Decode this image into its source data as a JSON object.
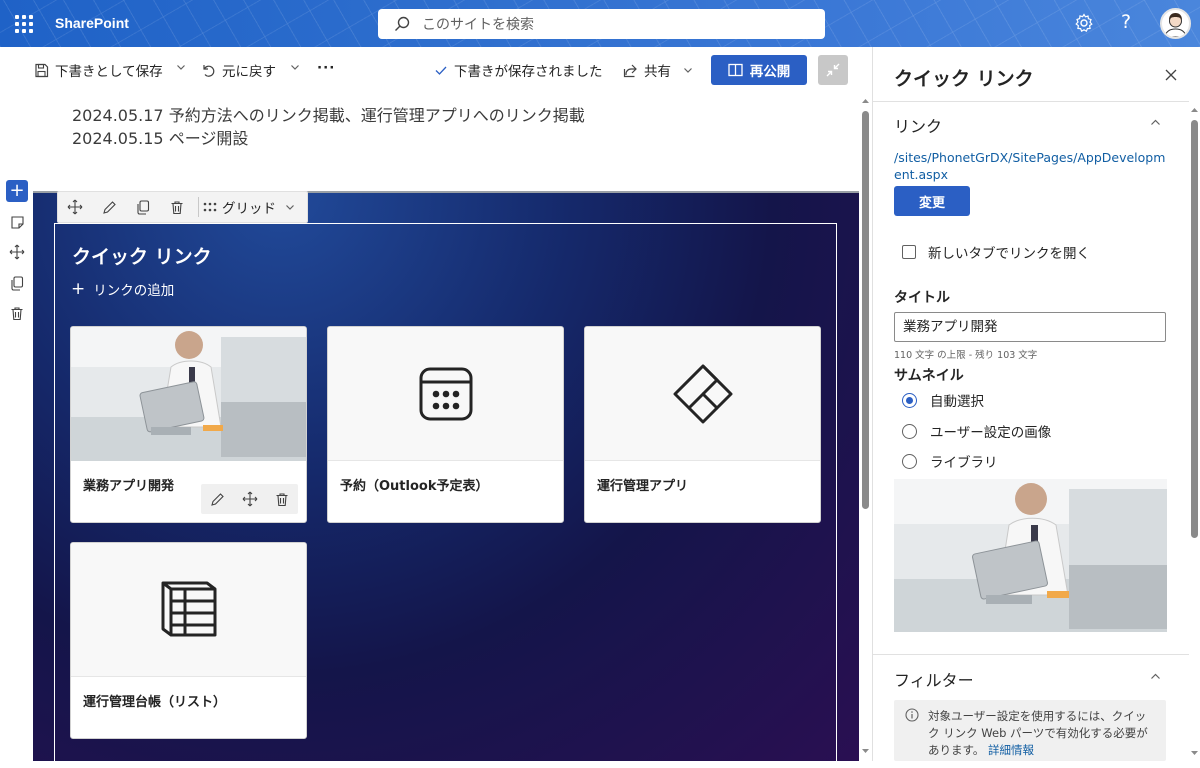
{
  "suitebar": {
    "brand": "SharePoint",
    "search_placeholder": "このサイトを検索"
  },
  "cmdbar": {
    "save_draft": "下書きとして保存",
    "undo": "元に戻す",
    "more": "···",
    "saved_status": "下書きが保存されました",
    "share": "共有",
    "republish": "再公開"
  },
  "content": {
    "news_lines": [
      "2024.05.17 予約方法へのリンク掲載、運行管理アプリへのリンク掲載",
      "2024.05.15 ページ開設"
    ],
    "webpart_toolbar": {
      "layout_label": "グリッド"
    },
    "quick_links": {
      "title": "クイック リンク",
      "add_link": "リンクの追加",
      "cards": [
        {
          "label": "業務アプリ開発",
          "thumb_icon": "photo-thumbnail"
        },
        {
          "label": "予約（Outlook予定表）",
          "thumb_icon": "calendar-icon"
        },
        {
          "label": "運行管理アプリ",
          "thumb_icon": "power-apps-icon"
        },
        {
          "label": "運行管理台帳（リスト）",
          "thumb_icon": "list-icon"
        }
      ]
    }
  },
  "panel": {
    "title": "クイック リンク",
    "link_section": {
      "heading": "リンク",
      "url": "/sites/PhonetGrDX/SitePages/AppDevelopment.aspx",
      "change_button": "変更",
      "new_tab_label": "新しいタブでリンクを開く",
      "new_tab_checked": false
    },
    "title_field": {
      "label": "タイトル",
      "value": "業務アプリ開発",
      "hint": "110 文字 の上限 - 残り 103 文字"
    },
    "thumbnail": {
      "label": "サムネイル",
      "options": [
        "自動選択",
        "ユーザー設定の画像",
        "ライブラリ"
      ],
      "selected": "自動選択"
    },
    "filter_section": {
      "heading": "フィルター",
      "info_text": "対象ユーザー設定を使用するには、クイック リンク Web パーツで有効化する必要があります。",
      "info_link": "詳細情報"
    }
  },
  "colors": {
    "accent": "#2b5fc4",
    "link": "#115ea3",
    "suitebar": "#2f6fce"
  }
}
